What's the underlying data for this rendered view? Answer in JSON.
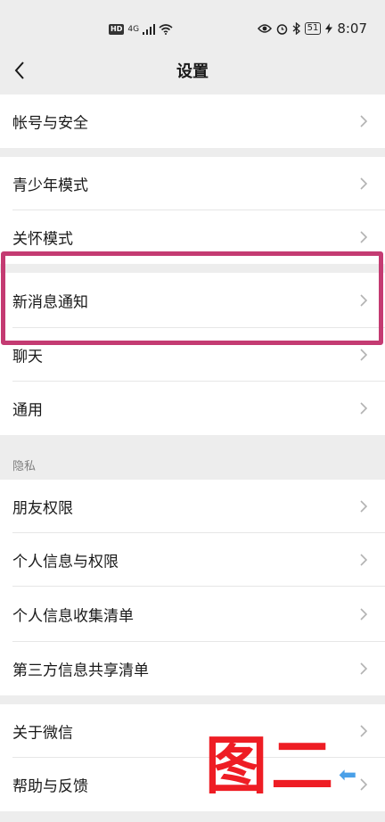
{
  "status_bar": {
    "hd": "HD",
    "network": "4G",
    "battery": "51",
    "time": "8:07"
  },
  "nav": {
    "title": "设置"
  },
  "groups": {
    "account": "帐号与安全",
    "youth_mode": "青少年模式",
    "care_mode": "关怀模式",
    "new_message": "新消息通知",
    "chat": "聊天",
    "general": "通用",
    "privacy_header": "隐私",
    "friend_permissions": "朋友权限",
    "personal_info_permissions": "个人信息与权限",
    "personal_info_list": "个人信息收集清单",
    "third_party_list": "第三方信息共享清单",
    "about": "关于微信",
    "help": "帮助与反馈"
  },
  "annotation": {
    "label_char_1": "图",
    "label_char_2": "二",
    "highlight_color": "#c43b72",
    "label_color": "#ee1d24",
    "arrow_color": "#4aa0e8",
    "arrow_glyph": "⬅"
  }
}
